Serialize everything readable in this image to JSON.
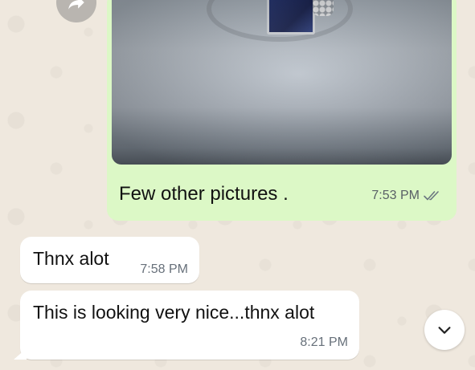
{
  "outgoing_message": {
    "caption": "Few other pictures .",
    "time": "7:53 PM",
    "status_icon": "double-check-icon"
  },
  "incoming_messages": [
    {
      "text": "Thnx alot",
      "time": "7:58 PM"
    },
    {
      "text": "This is looking very nice...thnx alot",
      "time": "8:21 PM"
    }
  ],
  "icons": {
    "forward": "forward-arrow-icon",
    "scroll_down": "chevron-down-icon"
  },
  "colors": {
    "outgoing_bubble": "#dcf8c6",
    "incoming_bubble": "#ffffff",
    "wallpaper": "#efe8de",
    "timestamp": "#67707a"
  }
}
